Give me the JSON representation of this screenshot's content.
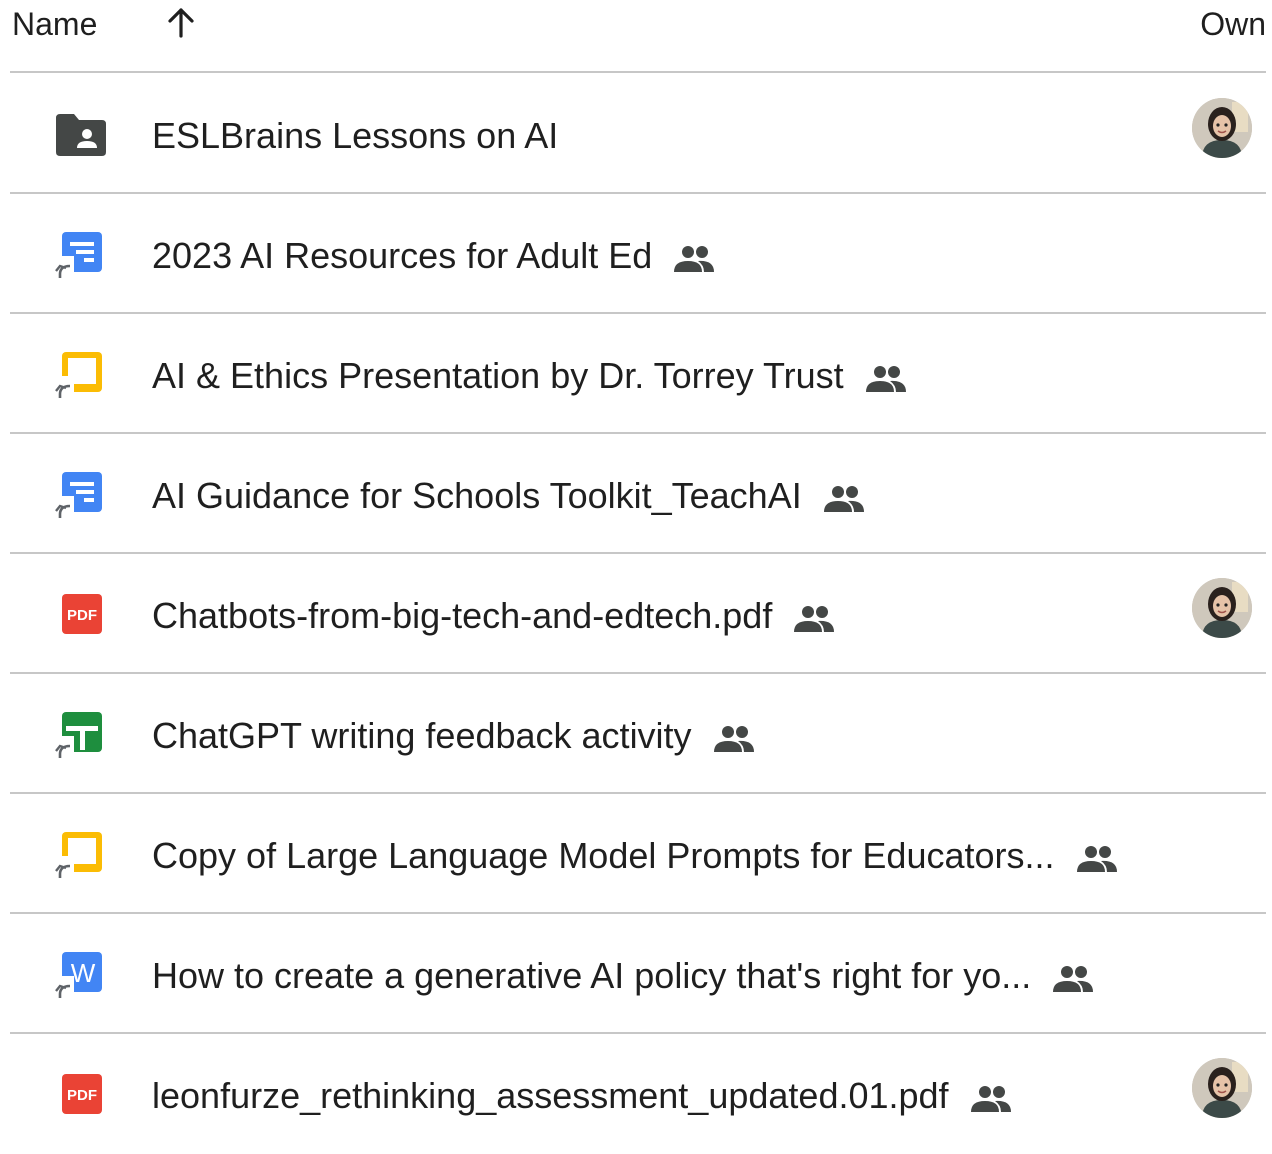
{
  "header": {
    "name_label": "Name",
    "owner_label": "Own",
    "sort_icon": "arrow-up-icon"
  },
  "files": [
    {
      "name": "ESLBrains Lessons on AI",
      "icon": "shared-folder-icon",
      "shared": false,
      "owner_avatar": true
    },
    {
      "name": "2023 AI Resources for Adult Ed",
      "icon": "google-forms-shortcut-icon",
      "shared": true,
      "owner_avatar": false
    },
    {
      "name": "AI & Ethics Presentation by Dr. Torrey Trust",
      "icon": "google-slides-shortcut-icon",
      "shared": true,
      "owner_avatar": false
    },
    {
      "name": "AI Guidance for Schools Toolkit_TeachAI",
      "icon": "google-forms-shortcut-icon",
      "shared": true,
      "owner_avatar": false
    },
    {
      "name": "Chatbots-from-big-tech-and-edtech.pdf",
      "icon": "pdf-icon",
      "shared": true,
      "owner_avatar": true
    },
    {
      "name": "ChatGPT writing feedback activity",
      "icon": "google-sheets-shortcut-icon",
      "shared": true,
      "owner_avatar": false
    },
    {
      "name": "Copy of Large Language Model Prompts for Educators...",
      "icon": "google-slides-shortcut-icon",
      "shared": true,
      "owner_avatar": false
    },
    {
      "name": "How to create a generative AI policy that's right for yo...",
      "icon": "word-doc-shortcut-icon",
      "shared": true,
      "owner_avatar": false
    },
    {
      "name": "leonfurze_rethinking_assessment_updated.01.pdf",
      "icon": "pdf-icon",
      "shared": true,
      "owner_avatar": true
    }
  ],
  "colors": {
    "forms_blue": "#4285f4",
    "slides_yellow": "#fbbc04",
    "sheets_green": "#1e8e3e",
    "pdf_red": "#ea4335",
    "folder_dark": "#444746",
    "text": "#1f1f1f",
    "divider": "#c7c7c7"
  },
  "pdf_badge": "PDF",
  "word_badge": "W"
}
